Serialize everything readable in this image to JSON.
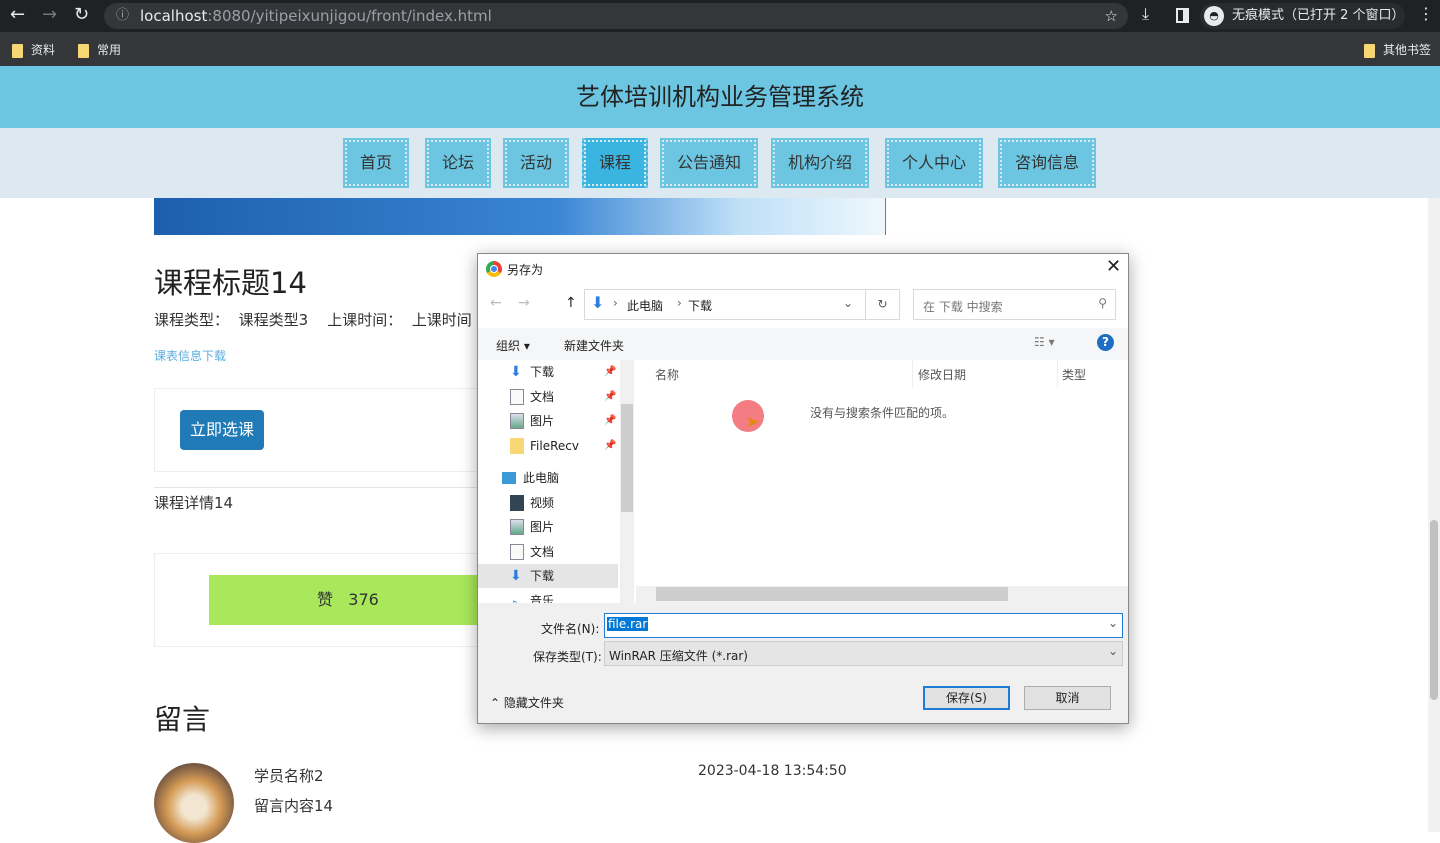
{
  "browser": {
    "url_host": "localhost",
    "url_rest": ":8080/yitipeixunjigou/front/index.html",
    "incognito": "无痕模式（已打开 2 个窗口）",
    "bookmarks": [
      "资料",
      "常用"
    ],
    "other_bookmarks": "其他书签"
  },
  "site": {
    "title": "艺体培训机构业务管理系统",
    "nav": [
      {
        "label": "首页"
      },
      {
        "label": "论坛"
      },
      {
        "label": "活动"
      },
      {
        "label": "课程",
        "active": true
      },
      {
        "label": "公告通知"
      },
      {
        "label": "机构介绍"
      },
      {
        "label": "个人中心"
      },
      {
        "label": "咨询信息"
      }
    ]
  },
  "course": {
    "title": "课程标题14",
    "type_label": "课程类型：",
    "type_value": "课程类型3",
    "time_label": "上课时间：",
    "time_value": "上课时间",
    "download_link": "课表信息下载",
    "enroll_button": "立即选课",
    "detail": "课程详情14",
    "like_label": "赞",
    "like_count": "376"
  },
  "comments": {
    "heading": "留言",
    "items": [
      {
        "name": "学员名称2",
        "content": "留言内容14",
        "time": "2023-04-18 13:54:50"
      }
    ]
  },
  "dialog": {
    "title": "另存为",
    "path": [
      "此电脑",
      "下载"
    ],
    "search_placeholder": "在 下载 中搜索",
    "organize": "组织",
    "new_folder": "新建文件夹",
    "quick_access": [
      {
        "label": "下载"
      },
      {
        "label": "文档"
      },
      {
        "label": "图片"
      },
      {
        "label": "FileRecv"
      }
    ],
    "this_pc": "此电脑",
    "pc_items": [
      {
        "label": "视频"
      },
      {
        "label": "图片"
      },
      {
        "label": "文档"
      },
      {
        "label": "下载",
        "selected": true
      },
      {
        "label": "音乐"
      }
    ],
    "columns": [
      "名称",
      "修改日期",
      "类型"
    ],
    "empty_message": "没有与搜索条件匹配的项。",
    "filename_label": "文件名(N):",
    "filename_value": "file.rar",
    "filetype_label": "保存类型(T):",
    "filetype_value": "WinRAR 压缩文件 (*.rar)",
    "hide_folders": "隐藏文件夹",
    "save": "保存(S)",
    "cancel": "取消"
  }
}
